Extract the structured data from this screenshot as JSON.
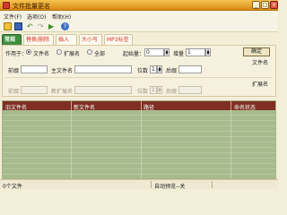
{
  "window": {
    "title": "文件批量更名"
  },
  "menu": {
    "file": "文件(F)",
    "options": "选项(O)",
    "help": "帮助(H)"
  },
  "tabs": [
    "常规",
    "替换/删除",
    "插入",
    "大小写",
    "MP3标签"
  ],
  "general": {
    "applies_to_label": "作用于：",
    "radio_filename": "文件名",
    "radio_extension": "扩展名",
    "radio_all": "全部",
    "selected": "文件名",
    "start_label": "起始量：",
    "start_value": "0",
    "increment_label": "增量",
    "increment_value": "1",
    "confirm_button": "确定",
    "filename_heading": "文件名",
    "prefix_label": "前缀",
    "prefix_value": "",
    "main_name_label": "主文件名",
    "main_name_value": "",
    "digits_label": "位数",
    "digits_value": "1",
    "suffix_label": "后缀",
    "suffix_value": "",
    "extension_heading": "扩展名",
    "ext_prefix_label": "前缀",
    "ext_prefix_value": "",
    "new_ext_label": "新扩展名",
    "new_ext_value": "",
    "ext_digits_label": "位数",
    "ext_digits_value": "1",
    "ext_suffix_label": "后缀",
    "ext_suffix_value": ""
  },
  "table": {
    "columns": [
      "旧文件名",
      "新文件名",
      "路径",
      "命名状态"
    ],
    "rows": []
  },
  "status": {
    "file_count": "0个文件",
    "auto_preview": "自动预览--关"
  },
  "colors": {
    "title_bar": "#e0a03a",
    "active_tab": "#3f8d3f",
    "grid_header": "#7e2f21",
    "grid_body": "#a7bb8e",
    "tab_text": "#d8362b"
  }
}
